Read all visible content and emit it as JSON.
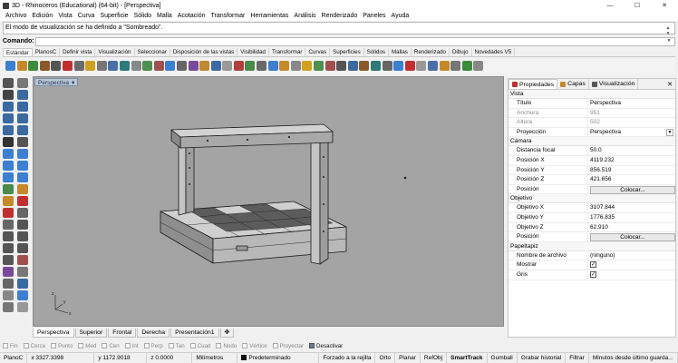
{
  "window": {
    "title": "3D - Rhinoceros (Educational) (64-bit) - [Perspectiva]"
  },
  "menu": [
    "Archivo",
    "Edición",
    "Vista",
    "Curva",
    "Superficie",
    "Sólido",
    "Malla",
    "Acotación",
    "Transformar",
    "Herramientas",
    "Análisis",
    "Renderizado",
    "Paneles",
    "Ayuda"
  ],
  "command": {
    "history": "El modo de visualización se ha definido a \"Sombreado\".",
    "label": "Comando:",
    "value": ""
  },
  "toolbar_tabs": [
    "Estándar",
    "PlanosC",
    "Definir vista",
    "Visualización",
    "Seleccionar",
    "Disposición de las vistas",
    "Visibilidad",
    "Transformar",
    "Curvas",
    "Superficies",
    "Sólidos",
    "Mallas",
    "Renderizado",
    "Dibujo",
    "Novedades V5"
  ],
  "viewport": {
    "title": "Perspectiva"
  },
  "viewport_tabs": [
    "Perspectiva",
    "Superior",
    "Frontal",
    "Derecha",
    "Presentación1"
  ],
  "osnaps": [
    {
      "label": "Fin",
      "on": false
    },
    {
      "label": "Cerca",
      "on": false
    },
    {
      "label": "Punto",
      "on": false
    },
    {
      "label": "Med",
      "on": false
    },
    {
      "label": "Cen",
      "on": false
    },
    {
      "label": "Int",
      "on": false
    },
    {
      "label": "Perp",
      "on": false
    },
    {
      "label": "Tan",
      "on": false
    },
    {
      "label": "Cuad",
      "on": false
    },
    {
      "label": "Nodo",
      "on": false
    },
    {
      "label": "Vértice",
      "on": false
    },
    {
      "label": "Proyectar",
      "on": false
    },
    {
      "label": "Desactivar",
      "on": true
    }
  ],
  "status": {
    "plane": "PlanoC",
    "x": "x 3327.3398",
    "y": "y 1172.9018",
    "z": "z 0.0000",
    "units": "Milímetros",
    "layer": "Predeterminado",
    "items": [
      "Forzado a la rejilla",
      "Orto",
      "Planar",
      "RefObj",
      "SmartTrack",
      "Gumball",
      "Grabar historial",
      "Filtrar",
      "Minutos desde último guarda..."
    ]
  },
  "panel": {
    "tabs": [
      "Propiedades",
      "Capas",
      "Visualización"
    ],
    "sections": [
      {
        "title": "Vista",
        "rows": [
          {
            "k": "Título",
            "v": "Perspectiva",
            "dim": false
          },
          {
            "k": "Anchura",
            "v": "951",
            "dim": true
          },
          {
            "k": "Altura",
            "v": "502",
            "dim": true
          },
          {
            "k": "Proyección",
            "v": "Perspectiva",
            "dim": false,
            "dropdown": true
          }
        ]
      },
      {
        "title": "Cámara",
        "rows": [
          {
            "k": "Distancia focal",
            "v": "50.0",
            "dim": false
          },
          {
            "k": "Posición X",
            "v": "4119.232",
            "dim": false
          },
          {
            "k": "Posición Y",
            "v": "856.519",
            "dim": false
          },
          {
            "k": "Posición Z",
            "v": "421.656",
            "dim": false
          },
          {
            "k": "Posición",
            "v": "Colocar...",
            "dim": false,
            "button": true
          }
        ]
      },
      {
        "title": "Objetivo",
        "rows": [
          {
            "k": "Objetivo X",
            "v": "3107.844",
            "dim": false
          },
          {
            "k": "Objetivo Y",
            "v": "1776.835",
            "dim": false
          },
          {
            "k": "Objetivo Z",
            "v": "62.910",
            "dim": false
          },
          {
            "k": "Posición",
            "v": "Colocar...",
            "dim": false,
            "button": true
          }
        ]
      },
      {
        "title": "Papeltapiz",
        "rows": [
          {
            "k": "Nombre de archivo",
            "v": "(ninguno)",
            "dim": false
          },
          {
            "k": "Mostrar",
            "v": "✓",
            "dim": false,
            "check": true
          },
          {
            "k": "Gris",
            "v": "✓",
            "dim": false,
            "check": true
          }
        ]
      }
    ]
  }
}
